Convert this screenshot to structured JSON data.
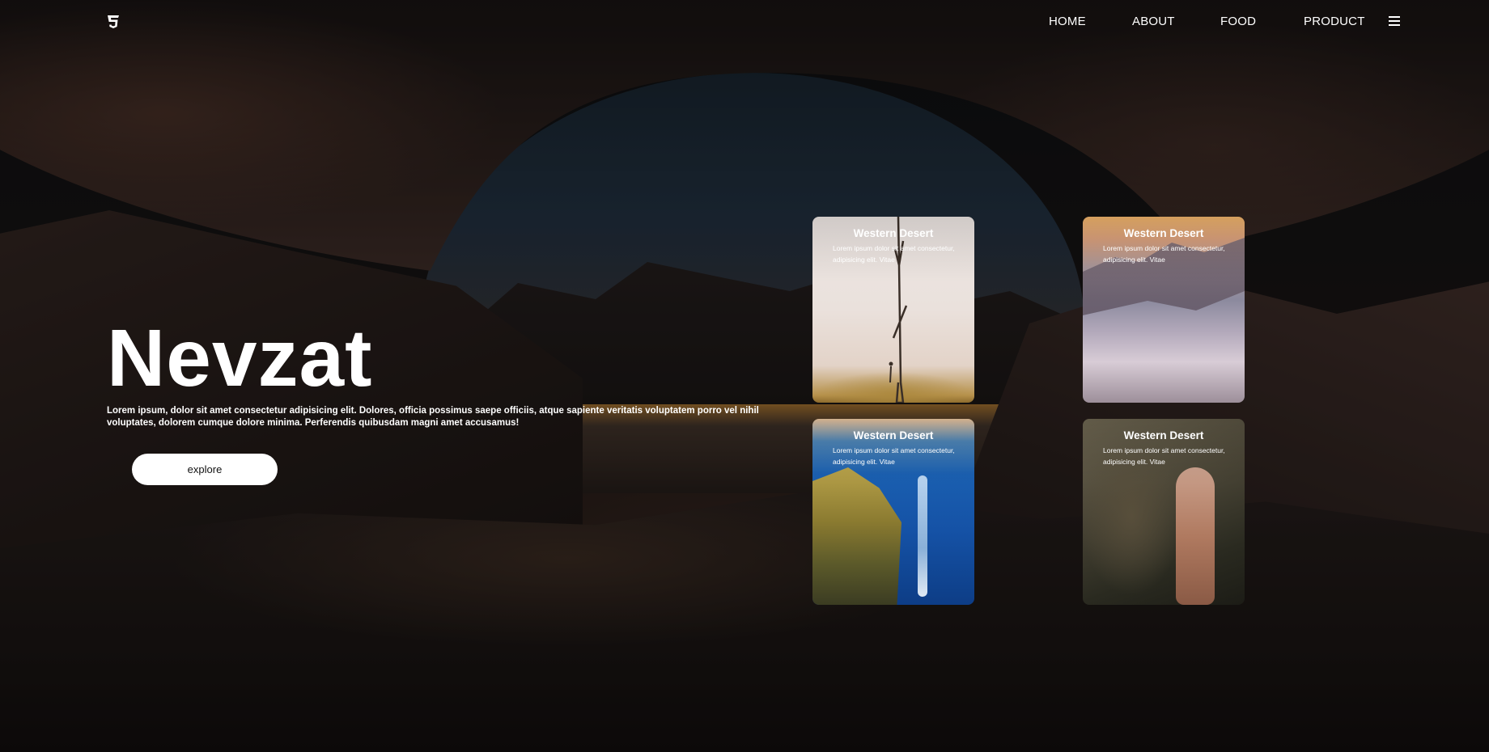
{
  "nav": {
    "logo_icon": "css3-icon",
    "links": [
      "HOME",
      "ABOUT",
      "FOOD",
      "PRODUCT"
    ],
    "menu_icon": "hamburger-menu-icon"
  },
  "hero": {
    "title": "Nevzat",
    "text": "Lorem ipsum, dolor sit amet consectetur adipisicing elit. Dolores, officia possimus saepe officiis, atque sapiente veritatis voluptatem porro vel nihil voluptates, dolorem cumque dolore minima. Perferendis quibusdam magni amet accusamus!",
    "button_label": "explore"
  },
  "cards": [
    {
      "title": "Western Desert",
      "text": "Lorem ipsum dolor sit amet consectetur, adipisicing elit. Vitae",
      "image": "misty-desert-tree"
    },
    {
      "title": "Western Desert",
      "text": "Lorem ipsum dolor sit amet consectetur, adipisicing elit. Vitae",
      "image": "rocky-desert"
    },
    {
      "title": "Western Desert",
      "text": "Lorem ipsum dolor sit amet consectetur, adipisicing elit. Vitae",
      "image": "underwater-diver"
    },
    {
      "title": "Western Desert",
      "text": "Lorem ipsum dolor sit amet consectetur, adipisicing elit. Vitae",
      "image": "man-with-camera"
    }
  ]
}
